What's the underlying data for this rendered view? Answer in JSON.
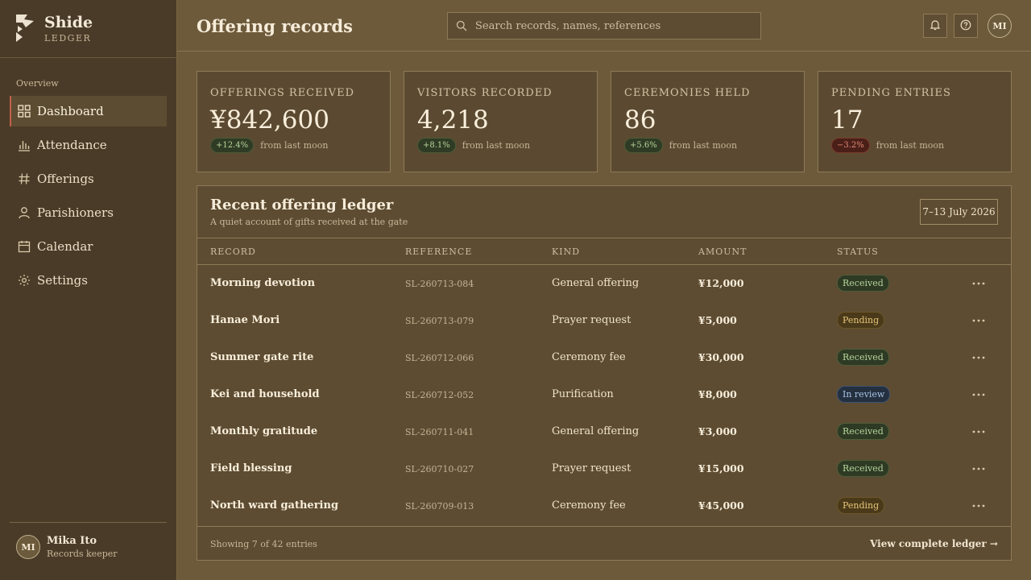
{
  "brand": {
    "name": "Shide",
    "sub": "LEDGER"
  },
  "sidebar": {
    "section": "Overview",
    "items": [
      {
        "label": "Dashboard",
        "icon": "grid-icon"
      },
      {
        "label": "Attendance",
        "icon": "bar-chart-icon"
      },
      {
        "label": "Offerings",
        "icon": "hash-icon"
      },
      {
        "label": "Parishioners",
        "icon": "person-icon"
      },
      {
        "label": "Calendar",
        "icon": "calendar-icon"
      },
      {
        "label": "Settings",
        "icon": "gear-icon"
      }
    ],
    "active": "Dashboard"
  },
  "user": {
    "initials": "MI",
    "name": "Mika Ito",
    "role": "Records keeper"
  },
  "header": {
    "title": "Offering records",
    "search_placeholder": "Search records, names, references",
    "avatar_initials": "MI"
  },
  "stats": [
    {
      "label": "OFFERINGS RECEIVED",
      "value": "¥842,600",
      "delta": "+12.4%",
      "trend": "up",
      "note": "from last moon"
    },
    {
      "label": "VISITORS RECORDED",
      "value": "4,218",
      "delta": "+8.1%",
      "trend": "up",
      "note": "from last moon"
    },
    {
      "label": "CEREMONIES HELD",
      "value": "86",
      "delta": "+5.6%",
      "trend": "up",
      "note": "from last moon"
    },
    {
      "label": "PENDING ENTRIES",
      "value": "17",
      "delta": "−3.2%",
      "trend": "down",
      "note": "from last moon"
    }
  ],
  "ledger": {
    "title": "Recent offering ledger",
    "subtitle": "A quiet account of gifts received at the gate",
    "date_range": "7–13 July 2026",
    "columns": [
      "RECORD",
      "REFERENCE",
      "KIND",
      "AMOUNT",
      "STATUS"
    ],
    "rows": [
      {
        "record": "Morning devotion",
        "reference": "SL-260713-084",
        "kind": "General offering",
        "amount": "¥12,000",
        "status": "Received"
      },
      {
        "record": "Hanae Mori",
        "reference": "SL-260713-079",
        "kind": "Prayer request",
        "amount": "¥5,000",
        "status": "Pending"
      },
      {
        "record": "Summer gate rite",
        "reference": "SL-260712-066",
        "kind": "Ceremony fee",
        "amount": "¥30,000",
        "status": "Received"
      },
      {
        "record": "Kei and household",
        "reference": "SL-260712-052",
        "kind": "Purification",
        "amount": "¥8,000",
        "status": "In review"
      },
      {
        "record": "Monthly gratitude",
        "reference": "SL-260711-041",
        "kind": "General offering",
        "amount": "¥3,000",
        "status": "Received"
      },
      {
        "record": "Field blessing",
        "reference": "SL-260710-027",
        "kind": "Prayer request",
        "amount": "¥15,000",
        "status": "Received"
      },
      {
        "record": "North ward gathering",
        "reference": "SL-260709-013",
        "kind": "Ceremony fee",
        "amount": "¥45,000",
        "status": "Pending"
      }
    ],
    "footer_text": "Showing 7 of 42 entries",
    "footer_link": "View complete ledger →"
  }
}
